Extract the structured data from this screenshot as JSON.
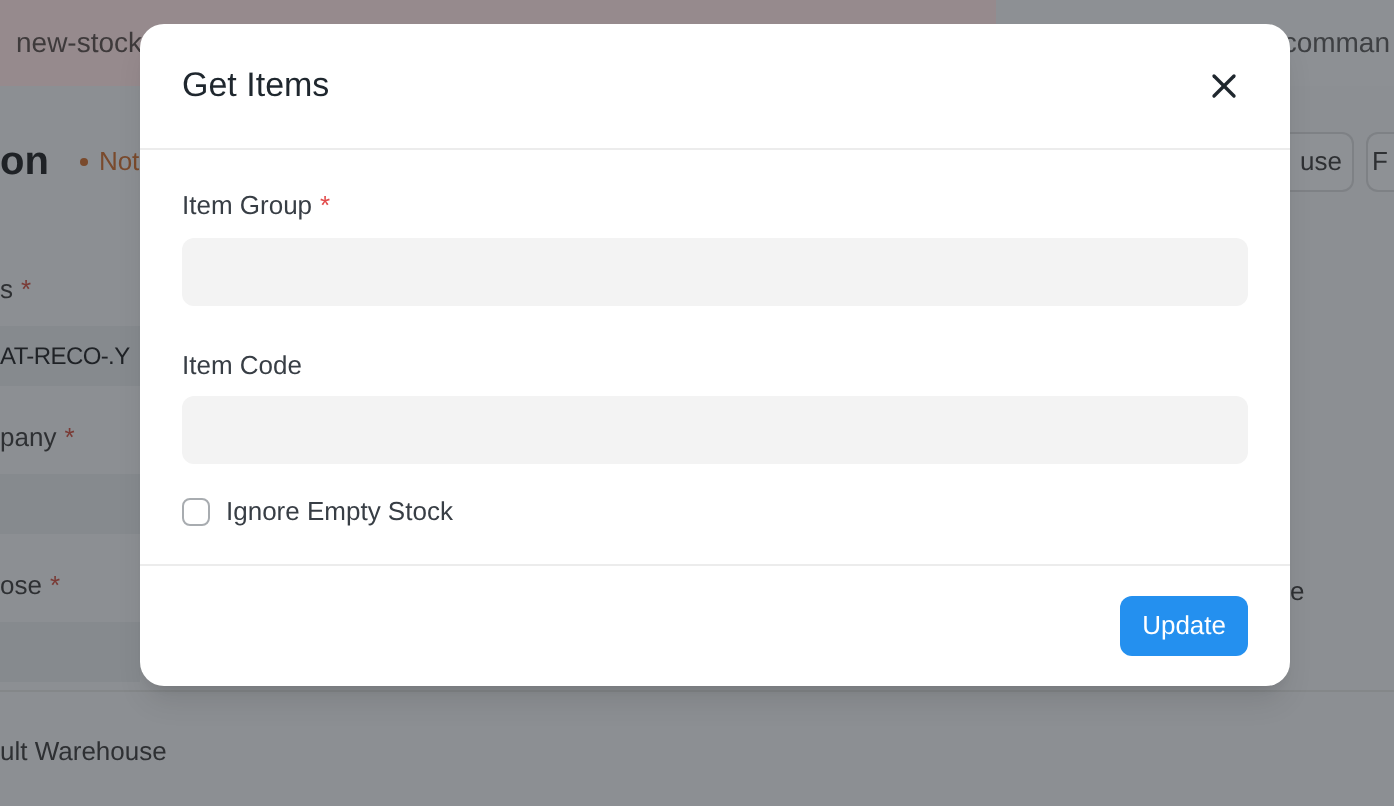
{
  "background": {
    "breadcrumb": "new-stock",
    "search_tail": "comman",
    "page_title_tail": "on",
    "status": "Not",
    "buttons": [
      "use",
      "F"
    ],
    "fields": [
      {
        "label": "s",
        "required_mark": "*",
        "value": "AT-RECO-.Y"
      },
      {
        "label": "pany",
        "required_mark": "*"
      },
      {
        "label": "ose",
        "required_mark": "*"
      }
    ],
    "right_label_tail": "e",
    "bottom_label": "ult Warehouse"
  },
  "dialog": {
    "title": "Get Items",
    "fields": [
      {
        "kind": "input",
        "label": "Item Group",
        "required_mark": "*"
      },
      {
        "kind": "input",
        "label": "Item Code"
      },
      {
        "kind": "checkbox",
        "label": "Ignore Empty Stock",
        "checked": false
      }
    ],
    "primary_button": "Update"
  }
}
